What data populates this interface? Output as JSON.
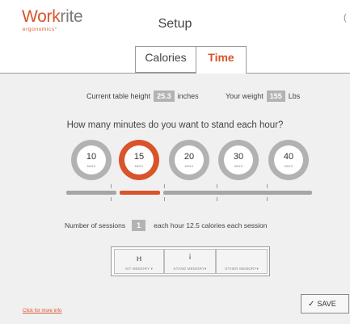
{
  "header": {
    "logo_accent": "Work",
    "logo_rest": "rite",
    "logo_sub": "ergonomics",
    "title": "Setup",
    "right_icon": "gear-icon"
  },
  "tabs": [
    {
      "label": "Calories",
      "active": false
    },
    {
      "label": "Time",
      "active": true
    }
  ],
  "table_height": {
    "label": "Current table height",
    "value": "25.3",
    "unit": "inches"
  },
  "weight": {
    "label": "Your weight",
    "value": "155",
    "unit": "Lbs"
  },
  "question": "How many minutes do you want to stand each hour?",
  "options": [
    {
      "value": "10",
      "unit": "MINS",
      "active": false
    },
    {
      "value": "15",
      "unit": "MINS",
      "active": true
    },
    {
      "value": "20",
      "unit": "MINS",
      "active": false
    },
    {
      "value": "30",
      "unit": "MINS",
      "active": false
    },
    {
      "value": "40",
      "unit": "MINS",
      "active": false
    }
  ],
  "sessions": {
    "label": "Number of sessions",
    "value": "1",
    "each_hour": "each hour",
    "calories": "12.5",
    "calories_label": "calories each session"
  },
  "memory": {
    "sit_label": "SIT MEMORY",
    "stand_label": "STAND MEMORY",
    "other_label": "OTHER MEMORY"
  },
  "save_label": "SAVE",
  "more_info": "Click for more info",
  "colors": {
    "accent": "#d9532b",
    "inactive": "#b2b2b2",
    "background": "#f0f0f0"
  }
}
